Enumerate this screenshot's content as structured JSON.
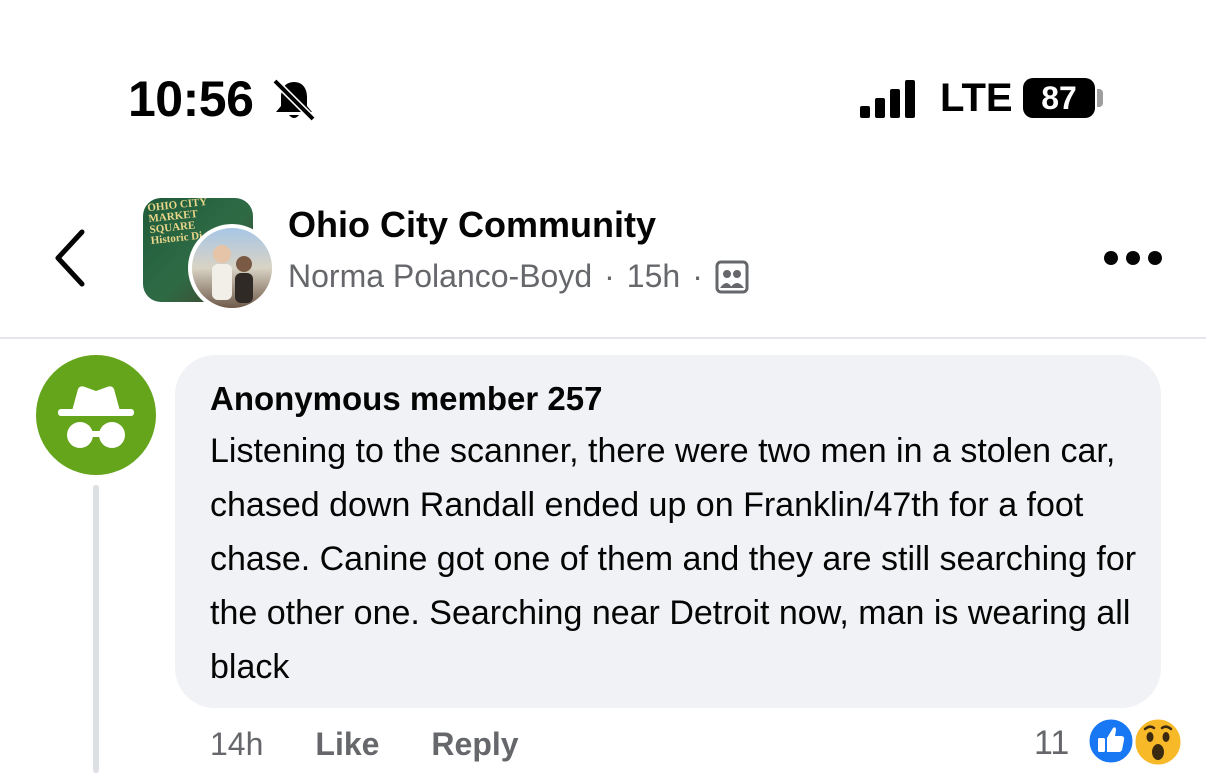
{
  "status_bar": {
    "time": "10:56",
    "network": "LTE",
    "battery": "87",
    "icons": [
      "bell-muted-icon",
      "signal-icon",
      "battery-icon"
    ]
  },
  "header": {
    "group_name": "Ohio City Community",
    "author": "Norma Polanco-Boyd",
    "separator": "·",
    "time": "15h",
    "thumb_sign_text": "OHIO CITY\nMARKET\nSQUARE\nHistoric Di",
    "icons": [
      "back-arrow-icon",
      "group-members-icon",
      "more-options-icon"
    ]
  },
  "comment": {
    "author": "Anonymous member 257",
    "text": "Listening to the scanner, there were two men in a stolen car, chased down Randall ended up on Franklin/47th for a foot chase. Canine got one of them and they are still searching for the other one. Searching near Detroit now, man is wearing all black",
    "time": "14h",
    "like_label": "Like",
    "reply_label": "Reply",
    "reaction_count": "11",
    "reactions": [
      "like-reaction-icon",
      "wow-reaction-icon"
    ]
  },
  "colors": {
    "anon_avatar": "#64a51c",
    "bubble": "#f0f2f5",
    "secondary_text": "#65676b",
    "like_blue": "#1877f2"
  }
}
